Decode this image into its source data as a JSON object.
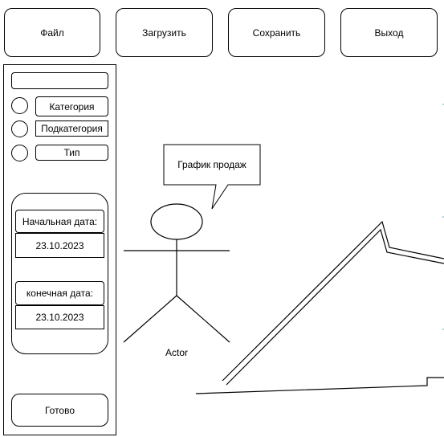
{
  "toolbar": {
    "file_label": "Файл",
    "load_label": "Загрузить",
    "save_label": "Сохранить",
    "exit_label": "Выход"
  },
  "sidebar": {
    "search_value": "",
    "filters": [
      {
        "label": "Категория"
      },
      {
        "label": "Подкатегория"
      },
      {
        "label": "Тип"
      }
    ],
    "date_panel": {
      "start_label": "Начальная дата:",
      "start_value": "23.10.2023",
      "end_label": "конечная дата:",
      "end_value": "23.10.2023"
    },
    "done_label": "Готово"
  },
  "canvas": {
    "callout_text": "График продаж",
    "actor_label": "Actor"
  }
}
